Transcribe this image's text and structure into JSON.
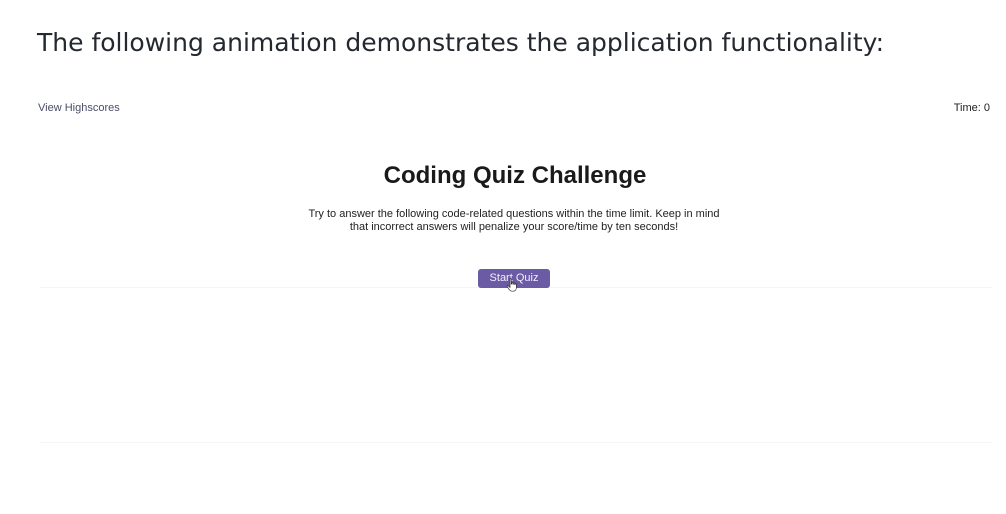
{
  "doc": {
    "intro_sentence": "The following animation demonstrates the application functionality:"
  },
  "app": {
    "highscores_link": "View Highscores",
    "timer_text": "Time: 0",
    "title": "Coding Quiz Challenge",
    "description": "Try to answer the following code-related questions within the time limit. Keep in mind that incorrect answers will penalize your score/time by ten seconds!",
    "start_button_label": "Start Quiz"
  },
  "icons": {
    "cursor": "hand-pointer-icon"
  },
  "colors": {
    "accent": "#6b5aa4",
    "link": "#4a4e6a"
  }
}
